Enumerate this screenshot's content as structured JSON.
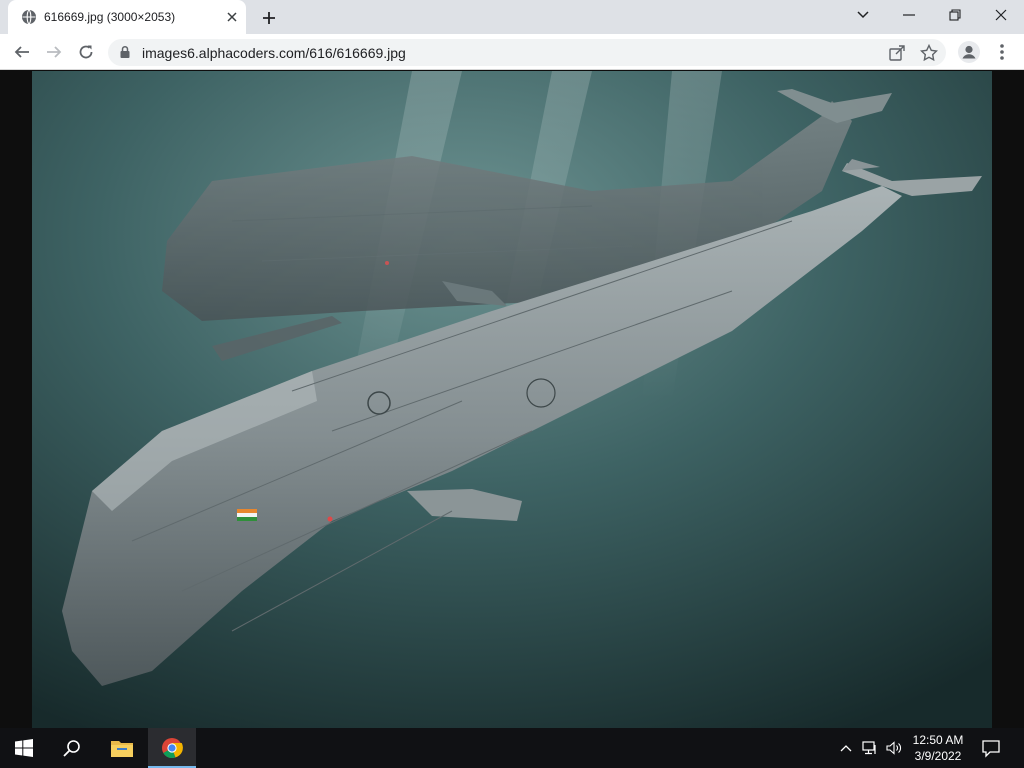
{
  "browser": {
    "tab_title": "616669.jpg (3000×2053)",
    "url": "images6.alphacoders.com/616/616669.jpg"
  },
  "icons": {
    "favicon": "globe-icon",
    "tab_close": "close-icon",
    "new_tab": "plus-icon",
    "dropdown": "chevron-down-icon",
    "minimize": "minimize-icon",
    "restore": "restore-icon",
    "close_window": "close-icon",
    "back": "back-arrow-icon",
    "forward": "forward-arrow-icon",
    "reload": "reload-icon",
    "lock": "lock-icon",
    "share": "share-icon",
    "bookmark": "star-icon",
    "profile": "profile-icon",
    "menu": "kebab-menu-icon"
  },
  "taskbar": {
    "time": "12:50 AM",
    "date": "3/9/2022",
    "apps": [
      "start-icon",
      "search-icon",
      "file-explorer-icon",
      "chrome-icon"
    ]
  },
  "colors": {
    "tabstrip": "#dee1e6",
    "water_dark": "#1a2f30",
    "water_light": "#5f8584",
    "whale_body": "#8f999c",
    "taskbar": "#101114",
    "taskbar_accent": "#76b9ed"
  }
}
